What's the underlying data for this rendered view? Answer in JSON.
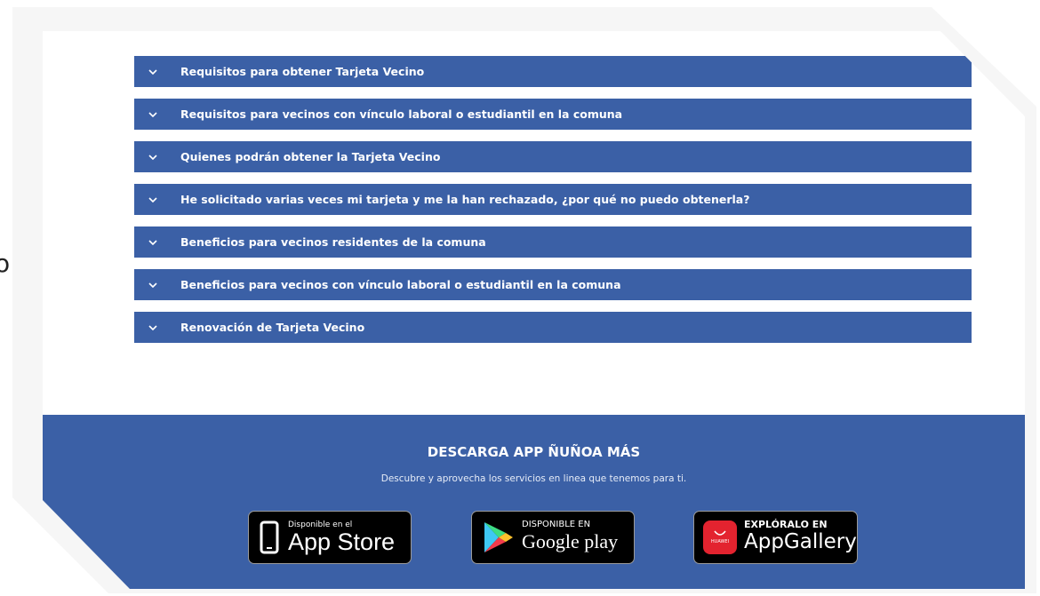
{
  "stray_text": "o",
  "accordion": {
    "items": [
      {
        "label": "Requisitos para obtener Tarjeta Vecino"
      },
      {
        "label": "Requisitos para vecinos con vínculo laboral o estudiantil en la comuna"
      },
      {
        "label": "Quienes podrán obtener la Tarjeta Vecino"
      },
      {
        "label": "He solicitado varias veces mi tarjeta y me la han rechazado, ¿por qué no puedo obtenerla?"
      },
      {
        "label": "Beneficios para vecinos residentes de la comuna"
      },
      {
        "label": "Beneficios para vecinos con vínculo laboral o estudiantil en la comuna"
      },
      {
        "label": "Renovación de Tarjeta Vecino"
      }
    ]
  },
  "footer": {
    "title": "DESCARGA APP ÑUÑOA MÁS",
    "subtitle": "Descubre y aprovecha los servicios en linea que tenemos para ti.",
    "badges": {
      "apple": {
        "small": "Disponible en el",
        "big": "App Store",
        "icon": "phone-icon"
      },
      "google": {
        "small": "DISPONIBLE EN",
        "big": "Google play",
        "icon": "play-triangle-icon"
      },
      "huawei": {
        "small": "EXPLÓRALO EN",
        "big": "AppGallery",
        "brand": "HUAWEI",
        "icon": "huawei-bag-icon"
      }
    }
  },
  "colors": {
    "accent": "#3b60a6",
    "badge_bg": "#000000",
    "huawei_red": "#e3232f"
  }
}
